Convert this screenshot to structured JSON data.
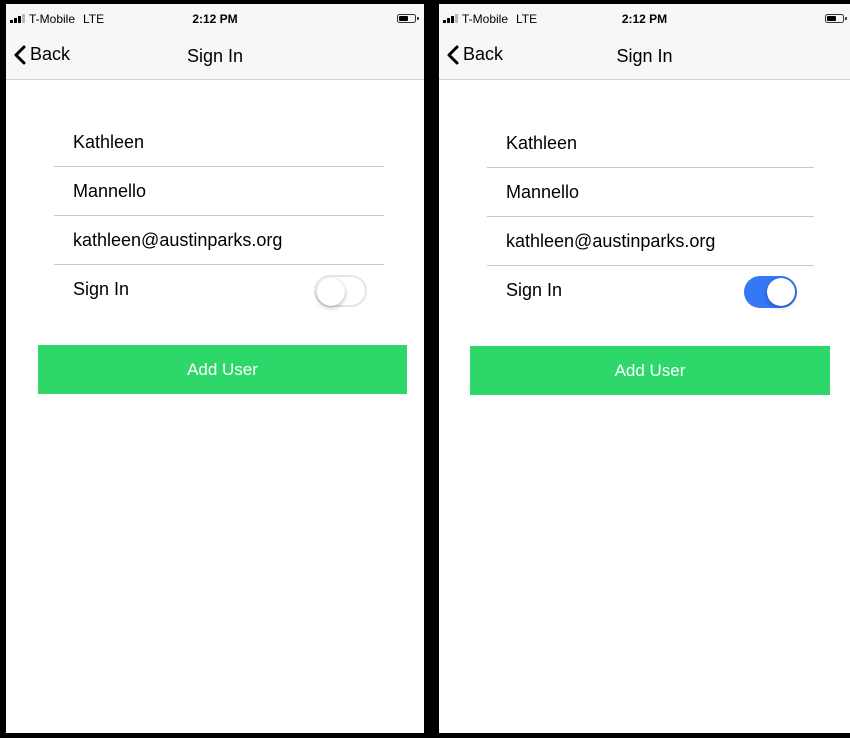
{
  "screens": [
    {
      "status": {
        "carrier": "T-Mobile",
        "network": "LTE",
        "time": "2:12 PM"
      },
      "nav": {
        "back_label": "Back",
        "title": "Sign In"
      },
      "form": {
        "first_name": "Kathleen",
        "last_name": "Mannello",
        "email": "kathleen@austinparks.org",
        "toggle_label": "Sign In",
        "toggle_on": false
      },
      "add_button_label": "Add User"
    },
    {
      "status": {
        "carrier": "T-Mobile",
        "network": "LTE",
        "time": "2:12 PM"
      },
      "nav": {
        "back_label": "Back",
        "title": "Sign In"
      },
      "form": {
        "first_name": "Kathleen",
        "last_name": "Mannello",
        "email": "kathleen@austinparks.org",
        "toggle_label": "Sign In",
        "toggle_on": true
      },
      "add_button_label": "Add User"
    }
  ],
  "colors": {
    "add_button": "#2ed76a",
    "toggle_on": "#3478f6",
    "toggle_off_border": "#e6e6e6",
    "bar_background": "#f7f7f7"
  },
  "icons": {
    "back": "chevron-left-icon",
    "signal": "signal-bars-icon",
    "battery": "battery-icon"
  }
}
